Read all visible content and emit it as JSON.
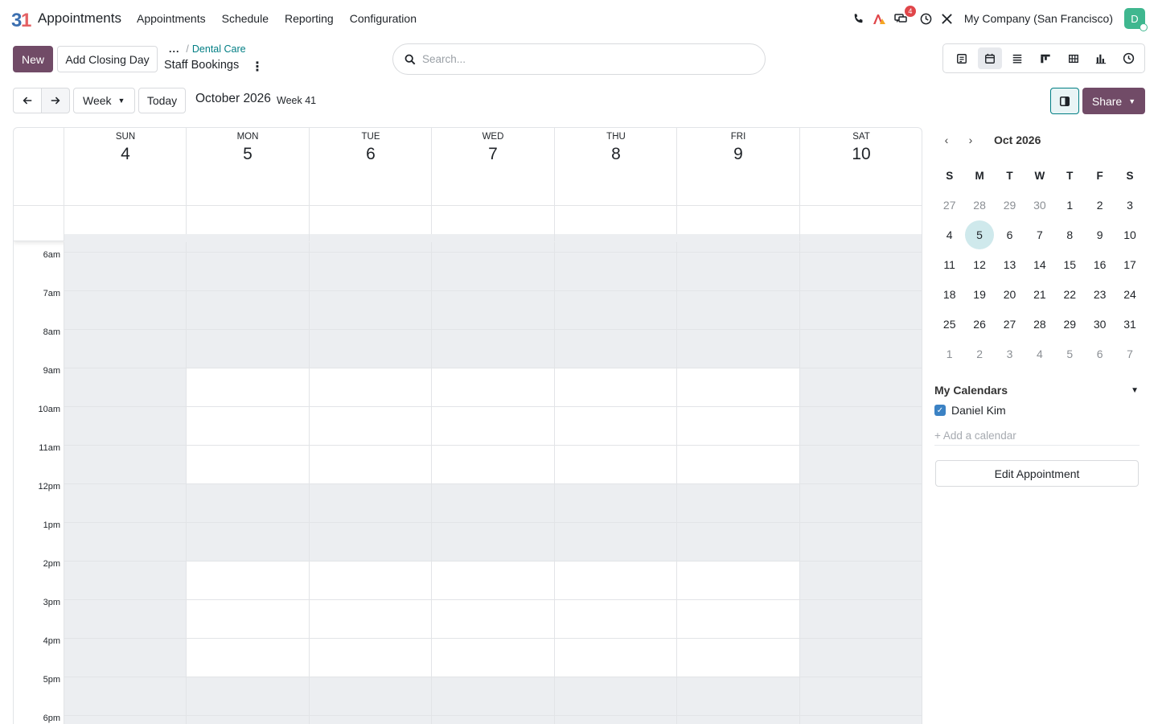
{
  "navbar": {
    "app_name": "Appointments",
    "menu": [
      "Appointments",
      "Schedule",
      "Reporting",
      "Configuration"
    ],
    "chat_badge": "4",
    "company": "My Company (San Francisco)",
    "avatar_initial": "D"
  },
  "control": {
    "new_label": "New",
    "closing_day_label": "Add Closing Day",
    "breadcrumb_parent": "Dental Care",
    "breadcrumb_sep": "/",
    "breadcrumb_dots": "...",
    "page_title": "Staff Bookings",
    "search_placeholder": "Search...",
    "week_label": "Week",
    "today_label": "Today",
    "period": "October 2026",
    "week_number": "Week 41",
    "share_label": "Share"
  },
  "calendar": {
    "days": [
      {
        "name": "SUN",
        "date": "4"
      },
      {
        "name": "MON",
        "date": "5"
      },
      {
        "name": "TUE",
        "date": "6"
      },
      {
        "name": "WED",
        "date": "7"
      },
      {
        "name": "THU",
        "date": "8"
      },
      {
        "name": "FRI",
        "date": "9"
      },
      {
        "name": "SAT",
        "date": "10"
      }
    ],
    "hours": [
      "6am",
      "7am",
      "8am",
      "9am",
      "10am",
      "11am",
      "12pm",
      "1pm",
      "2pm",
      "3pm",
      "4pm",
      "5pm",
      "6pm"
    ],
    "available_hours": [
      "9am",
      "10am",
      "11am",
      "2pm",
      "3pm",
      "4pm"
    ],
    "available_days": [
      "MON",
      "TUE",
      "WED",
      "THU",
      "FRI"
    ]
  },
  "mini_calendar": {
    "title": "Oct 2026",
    "weekday_headers": [
      "S",
      "M",
      "T",
      "W",
      "T",
      "F",
      "S"
    ],
    "weeks": [
      [
        "27",
        "28",
        "29",
        "30",
        "1",
        "2",
        "3"
      ],
      [
        "4",
        "5",
        "6",
        "7",
        "8",
        "9",
        "10"
      ],
      [
        "11",
        "12",
        "13",
        "14",
        "15",
        "16",
        "17"
      ],
      [
        "18",
        "19",
        "20",
        "21",
        "22",
        "23",
        "24"
      ],
      [
        "25",
        "26",
        "27",
        "28",
        "29",
        "30",
        "31"
      ],
      [
        "1",
        "2",
        "3",
        "4",
        "5",
        "6",
        "7"
      ]
    ],
    "selected": "5"
  },
  "sidebar": {
    "my_calendars": "My Calendars",
    "calendar_user": "Daniel Kim",
    "add_calendar": "+ Add a calendar",
    "edit_button": "Edit Appointment"
  },
  "colors": {
    "primary": "#714b67",
    "link": "#017e84",
    "unavailable": "#eceef1",
    "selected_day": "#cfe9ec"
  }
}
